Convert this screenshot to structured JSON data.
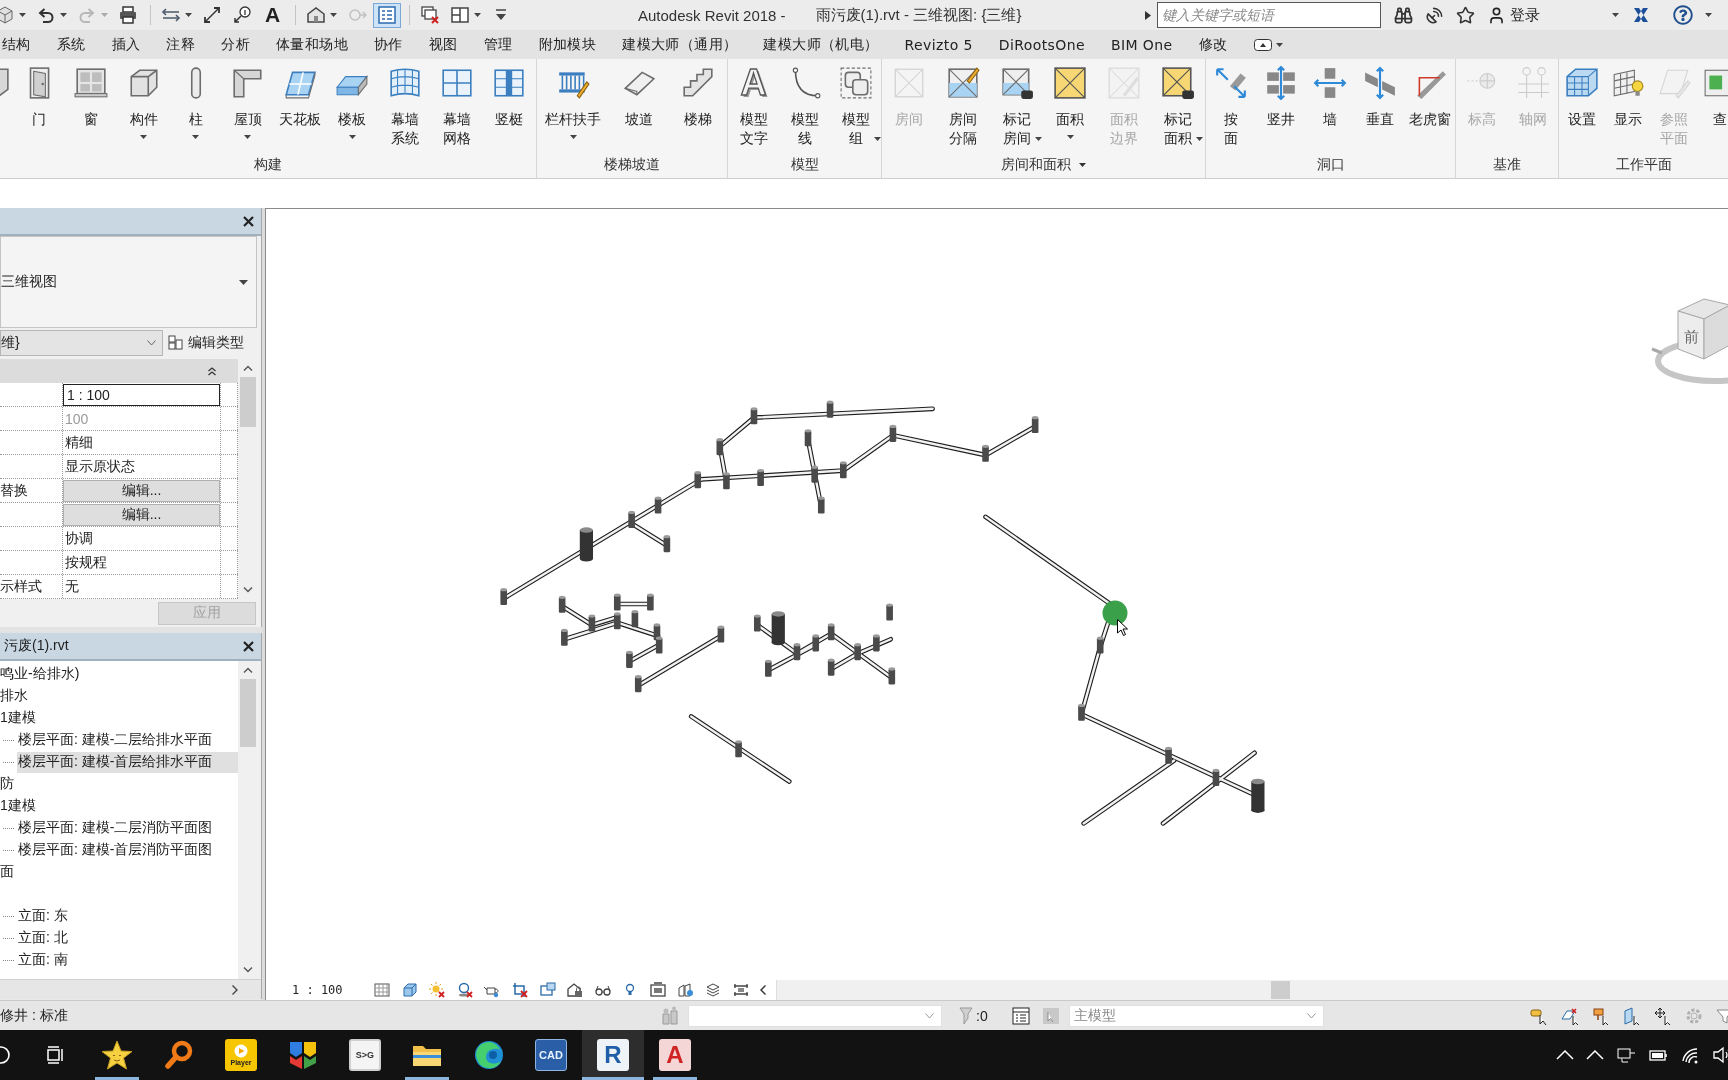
{
  "title_bar": {
    "quick_access": [
      {
        "dropdown": true,
        "disabled": false,
        "on": false
      },
      {
        "dropdown": true,
        "disabled": false,
        "on": false
      },
      {
        "dropdown": true,
        "disabled": true,
        "on": false
      },
      {
        "dropdown": false,
        "disabled": false,
        "on": false
      },
      {
        "dropdown": true,
        "disabled": false,
        "on": false
      },
      {
        "dropdown": false,
        "disabled": false,
        "on": false
      },
      {
        "dropdown": false,
        "disabled": false,
        "on": false
      },
      {
        "glyph": "A",
        "dropdown": false,
        "disabled": false,
        "on": false
      },
      {
        "dropdown": true,
        "disabled": false,
        "on": false
      },
      {
        "dropdown": false,
        "disabled": true,
        "on": false
      },
      {
        "dropdown": false,
        "disabled": false,
        "on": true
      },
      {
        "dropdown": false,
        "disabled": false,
        "on": false
      },
      {
        "dropdown": true,
        "disabled": false,
        "on": false
      },
      {
        "dropdown": false,
        "disabled": false,
        "on": false
      }
    ],
    "app_name": "Autodesk Revit 2018 -",
    "document": "雨污废(1).rvt - 三维视图: {三维}",
    "search": {
      "placeholder": "键入关键字或短语"
    },
    "sign_in": "登录"
  },
  "menu_tabs": [
    {
      "label": "结构",
      "selected": false
    },
    {
      "label": "系统",
      "selected": false
    },
    {
      "label": "插入",
      "selected": false
    },
    {
      "label": "注释",
      "selected": false
    },
    {
      "label": "分析",
      "selected": false
    },
    {
      "label": "体量和场地",
      "selected": false
    },
    {
      "label": "协作",
      "selected": false
    },
    {
      "label": "视图",
      "selected": false
    },
    {
      "label": "管理",
      "selected": false
    },
    {
      "label": "附加模块",
      "selected": false
    },
    {
      "label": "建模大师（通用）",
      "selected": false
    },
    {
      "label": "建模大师（机电）",
      "selected": false
    },
    {
      "label": "Revizto 5",
      "selected": false
    },
    {
      "label": "DiRootsOne",
      "selected": false
    },
    {
      "label": "BIM One",
      "selected": false
    },
    {
      "label": "修改",
      "selected": false
    }
  ],
  "ribbon": {
    "panels": [
      {
        "title": "构建",
        "menu": false,
        "buttons": [
          {
            "dropdown": false,
            "disabled": false
          },
          {
            "label": "门",
            "dropdown": false,
            "disabled": false
          },
          {
            "label": "窗",
            "dropdown": false,
            "disabled": false
          },
          {
            "label": "构件",
            "dropdown": true,
            "disabled": false
          },
          {
            "label": "柱",
            "dropdown": true,
            "disabled": false
          },
          {
            "label": "屋顶",
            "dropdown": true,
            "disabled": false
          },
          {
            "label": "天花板",
            "dropdown": false,
            "disabled": false
          },
          {
            "label": "楼板",
            "dropdown": true,
            "disabled": false
          },
          {
            "label": "幕墙系统",
            "dropdown": false,
            "disabled": false
          },
          {
            "label": "幕墙网格",
            "dropdown": false,
            "disabled": false
          },
          {
            "label": "竖梃",
            "dropdown": false,
            "disabled": false
          }
        ]
      },
      {
        "title": "楼梯坡道",
        "menu": false,
        "buttons": [
          {
            "label": "栏杆扶手",
            "dropdown": true,
            "disabled": false
          },
          {
            "label": "坡道",
            "dropdown": false,
            "disabled": false
          },
          {
            "label": "楼梯",
            "dropdown": false,
            "disabled": false
          }
        ]
      },
      {
        "title": "模型",
        "menu": false,
        "buttons": [
          {
            "label": "模型文字",
            "glyph": "A",
            "dropdown": false,
            "disabled": false
          },
          {
            "label": "模型线",
            "dropdown": false,
            "disabled": false
          },
          {
            "label": "模型组",
            "dropdown": true,
            "disabled": false
          }
        ]
      },
      {
        "title": "房间和面积",
        "menu": true,
        "buttons": [
          {
            "label": "房间",
            "dropdown": false,
            "disabled": true
          },
          {
            "label": "房间分隔",
            "dropdown": false,
            "disabled": false
          },
          {
            "label": "标记房间",
            "dropdown": true,
            "disabled": false
          },
          {
            "label": "面积",
            "dropdown": true,
            "disabled": false
          },
          {
            "label": "面积边界",
            "dropdown": false,
            "disabled": true
          },
          {
            "label": "标记面积",
            "dropdown": true,
            "disabled": false
          }
        ]
      },
      {
        "title": "洞口",
        "menu": false,
        "buttons": [
          {
            "label": "按面",
            "dropdown": false,
            "disabled": false
          },
          {
            "label": "竖井",
            "dropdown": false,
            "disabled": false
          },
          {
            "label": "墙",
            "dropdown": false,
            "disabled": false
          },
          {
            "label": "垂直",
            "dropdown": false,
            "disabled": false
          },
          {
            "label": "老虎窗",
            "dropdown": false,
            "disabled": false
          }
        ]
      },
      {
        "title": "基准",
        "menu": false,
        "buttons": [
          {
            "label": "标高",
            "dropdown": false,
            "disabled": true
          },
          {
            "label": "轴网",
            "dropdown": false,
            "disabled": true
          }
        ]
      },
      {
        "title": "工作平面",
        "menu": false,
        "buttons": [
          {
            "label": "设置",
            "dropdown": false,
            "disabled": false
          },
          {
            "label": "显示",
            "dropdown": false,
            "disabled": false
          },
          {
            "label": "参照平面",
            "dropdown": false,
            "disabled": true
          },
          {
            "label": "查",
            "dropdown": false,
            "disabled": false
          }
        ]
      }
    ]
  },
  "properties": {
    "type": "三维视图",
    "view_dropdown": "维}",
    "edit_type": "编辑类型",
    "rows": [
      {
        "kind": "input",
        "value": "1 : 100"
      },
      {
        "kind": "readonly",
        "value": "100"
      },
      {
        "kind": "text",
        "value": "精细"
      },
      {
        "kind": "text",
        "value": "显示原状态"
      },
      {
        "kind": "button",
        "name": "替换",
        "value": "编辑..."
      },
      {
        "kind": "button",
        "value": "编辑..."
      },
      {
        "kind": "text",
        "value": "协调"
      },
      {
        "kind": "text",
        "value": "按规程"
      },
      {
        "kind": "text",
        "name": "示样式",
        "value": "无"
      }
    ],
    "apply": {
      "label": "应用",
      "disabled": true
    }
  },
  "project_browser": {
    "title": "污废(1).rvt",
    "tree": [
      {
        "kind": "folder",
        "label": "鸣业-给排水)",
        "selected": false,
        "children": [
          {
            "kind": "folder",
            "label": "排水",
            "selected": false,
            "children": [
              {
                "kind": "folder",
                "label": "1建模",
                "selected": false,
                "children": [
                  {
                    "kind": "view",
                    "label": "楼层平面: 建模-二层给排水平面",
                    "selected": false
                  },
                  {
                    "kind": "view",
                    "label": "楼层平面: 建模-首层给排水平面",
                    "selected": true
                  }
                ]
              }
            ]
          },
          {
            "kind": "folder",
            "label": "防",
            "selected": false,
            "children": [
              {
                "kind": "folder",
                "label": "1建模",
                "selected": false,
                "children": [
                  {
                    "kind": "view",
                    "label": "楼层平面: 建模-二层消防平面图",
                    "selected": false
                  },
                  {
                    "kind": "view",
                    "label": "楼层平面: 建模-首层消防平面图",
                    "selected": false
                  }
                ]
              }
            ]
          }
        ]
      },
      {
        "kind": "folder",
        "label": "面",
        "selected": false
      },
      {
        "kind": "folder",
        "selected": false,
        "children": [
          {
            "kind": "view",
            "label": "立面: 东",
            "selected": false
          },
          {
            "kind": "view",
            "label": "立面: 北",
            "selected": false
          },
          {
            "kind": "view",
            "label": "立面: 南",
            "selected": false
          }
        ]
      }
    ]
  },
  "view": {
    "view_cube": {
      "face_label": "前"
    },
    "scale": "1 : 100"
  },
  "status_bar": {
    "selection": "修井 : 标准",
    "filter_count": ":0",
    "model_field": {
      "value": "主模型",
      "disabled": true
    }
  },
  "taskbar": {
    "apps": [
      {
        "running": true,
        "selected": false
      },
      {
        "running": false,
        "selected": false
      },
      {
        "glyph": "Player",
        "running": false,
        "selected": false
      },
      {
        "running": false,
        "selected": false
      },
      {
        "glyph": "S>G",
        "running": false,
        "selected": false
      },
      {
        "running": true,
        "selected": false
      },
      {
        "running": false,
        "selected": false
      },
      {
        "glyph": "CAD",
        "running": false,
        "selected": false
      },
      {
        "glyph": "R",
        "running": true,
        "selected": true
      },
      {
        "glyph": "A",
        "running": true,
        "selected": false
      }
    ]
  }
}
